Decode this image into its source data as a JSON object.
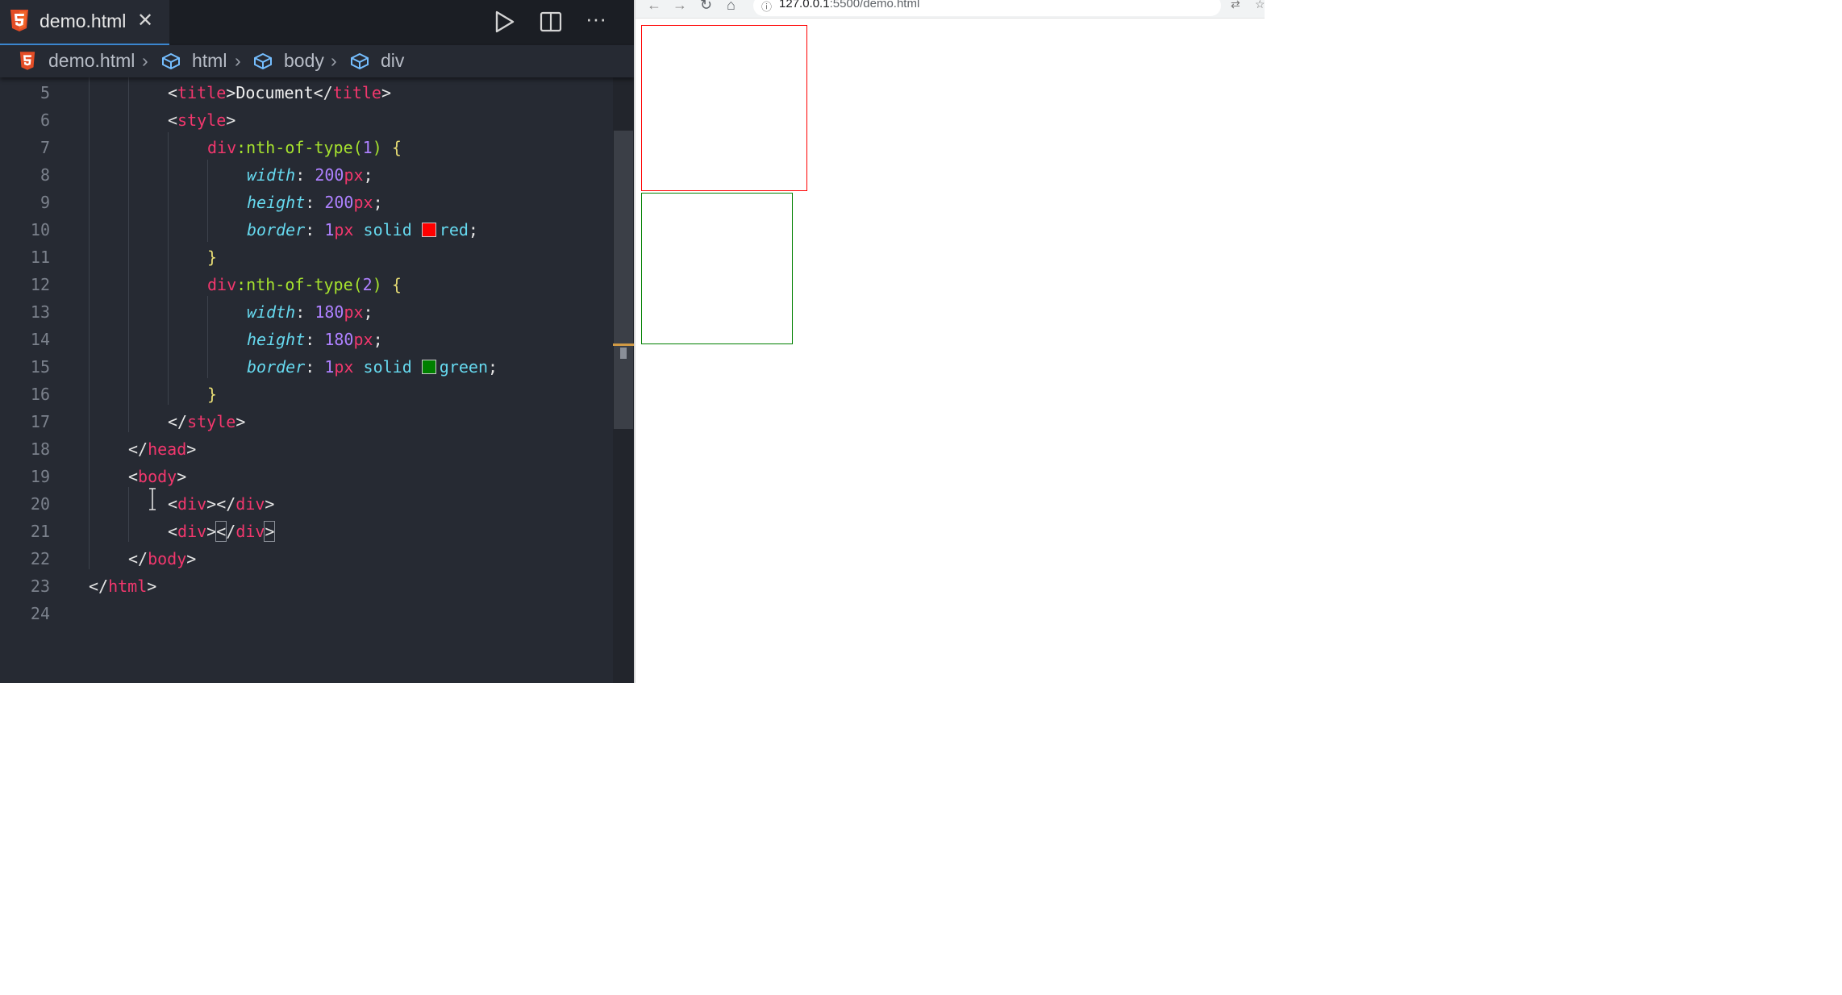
{
  "editor": {
    "tab": {
      "label": "demo.html",
      "close": "✕"
    },
    "toolbar": {
      "run_icon": "play-icon",
      "split_icon": "split-editor-icon",
      "more": "···"
    },
    "breadcrumb": [
      {
        "label": "demo.html",
        "icon": "html5-icon"
      },
      {
        "label": "html",
        "icon": "cube-icon"
      },
      {
        "label": "body",
        "icon": "cube-icon"
      },
      {
        "label": "div",
        "icon": "cube-icon"
      }
    ],
    "line_numbers": [
      "5",
      "6",
      "7",
      "8",
      "9",
      "10",
      "11",
      "12",
      "13",
      "14",
      "15",
      "16",
      "17",
      "18",
      "19",
      "20",
      "21",
      "22",
      "23",
      "24"
    ],
    "code": {
      "l5_title": "Document",
      "title_tag": "title",
      "style_tag": "style",
      "selector_div": "div",
      "pseudo": ":nth-of-type(",
      "n1": "1",
      "n2": "2",
      "width_prop": "width",
      "height_prop": "height",
      "border_prop": "border",
      "v200": "200",
      "v180": "180",
      "px": "px",
      "one": "1",
      "solid": "solid",
      "red": "red",
      "green": "green",
      "head_tag": "head",
      "body_tag": "body",
      "div_tag": "div",
      "html_tag": "html"
    },
    "colors": {
      "red_swatch": "#ff0000",
      "green_swatch": "#008000"
    }
  },
  "browser": {
    "url_host": "127.0.0.1",
    "url_rest": ":5500/demo.html",
    "nav": {
      "back": "←",
      "forward": "→",
      "reload": "↻",
      "home": "⌂",
      "info": "ⓘ"
    }
  }
}
